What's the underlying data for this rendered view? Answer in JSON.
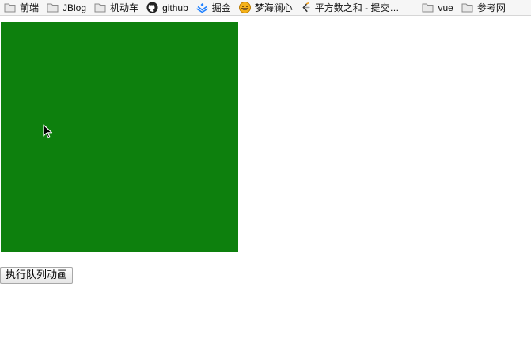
{
  "bookmarks": {
    "items": [
      {
        "label": "前端",
        "icon": "folder-icon"
      },
      {
        "label": "JBlog",
        "icon": "folder-icon"
      },
      {
        "label": "机动车",
        "icon": "folder-icon"
      },
      {
        "label": "github",
        "icon": "github-icon"
      },
      {
        "label": "掘金",
        "icon": "juejin-icon"
      },
      {
        "label": "梦海澜心",
        "icon": "smiley-icon"
      },
      {
        "label": "平方数之和 - 提交…",
        "icon": "leetcode-icon"
      },
      {
        "label": "vue",
        "icon": "folder-icon"
      },
      {
        "label": "参考网",
        "icon": "folder-icon"
      }
    ]
  },
  "main": {
    "box_color": "#0d800d",
    "button_label": "执行队列动画"
  }
}
